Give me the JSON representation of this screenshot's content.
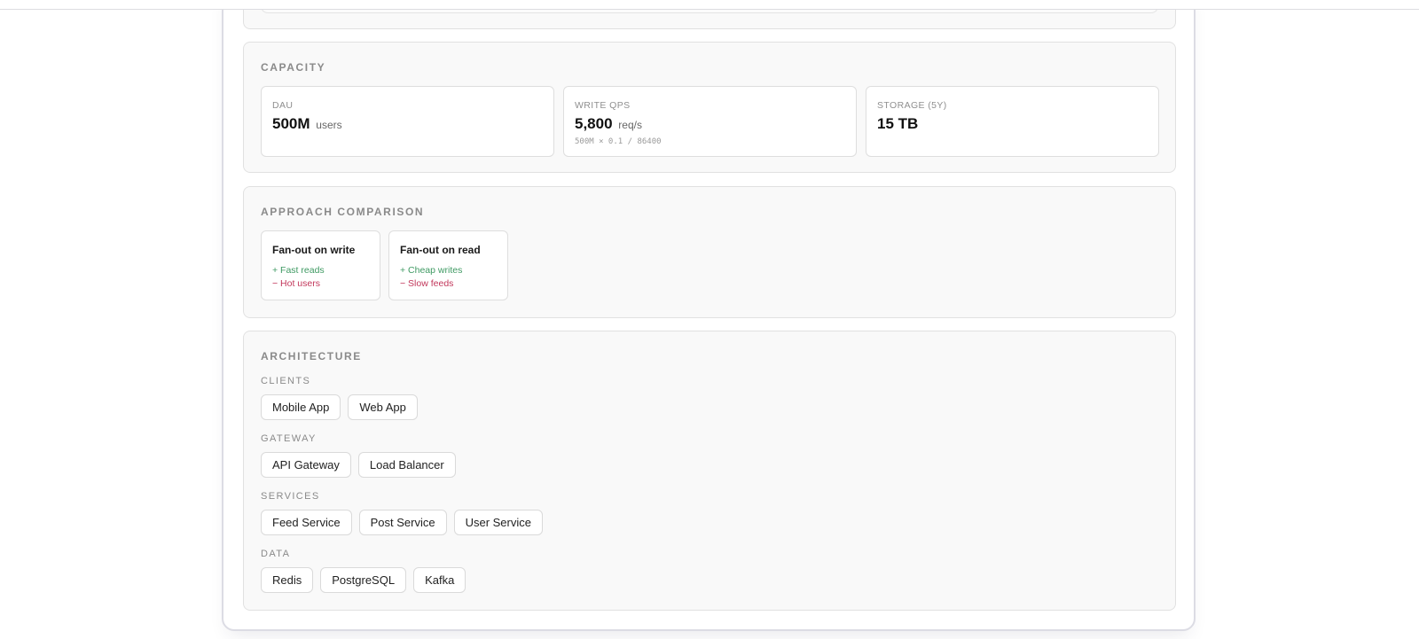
{
  "sections": {
    "capacity": {
      "title": "CAPACITY",
      "metrics": [
        {
          "label": "DAU",
          "value": "500M",
          "unit": "users",
          "formula": ""
        },
        {
          "label": "WRITE QPS",
          "value": "5,800",
          "unit": "req/s",
          "formula": "500M × 0.1 / 86400"
        },
        {
          "label": "STORAGE (5Y)",
          "value": "15 TB",
          "unit": "",
          "formula": ""
        }
      ]
    },
    "approach": {
      "title": "APPROACH COMPARISON",
      "options": [
        {
          "name": "Fan-out on write",
          "pro": "+ Fast reads",
          "con": "− Hot users"
        },
        {
          "name": "Fan-out on read",
          "pro": "+ Cheap writes",
          "con": "− Slow feeds"
        }
      ]
    },
    "architecture": {
      "title": "ARCHITECTURE",
      "layers": [
        {
          "title": "CLIENTS",
          "items": [
            "Mobile App",
            "Web App"
          ]
        },
        {
          "title": "GATEWAY",
          "items": [
            "API Gateway",
            "Load Balancer"
          ]
        },
        {
          "title": "SERVICES",
          "items": [
            "Feed Service",
            "Post Service",
            "User Service"
          ]
        },
        {
          "title": "DATA",
          "items": [
            "Redis",
            "PostgreSQL",
            "Kafka"
          ]
        }
      ]
    }
  },
  "colors": {
    "pro": "#3f9a63",
    "con": "#c2375b",
    "panel_bg": "#f9f9f9",
    "border": "#e1e1e1"
  }
}
